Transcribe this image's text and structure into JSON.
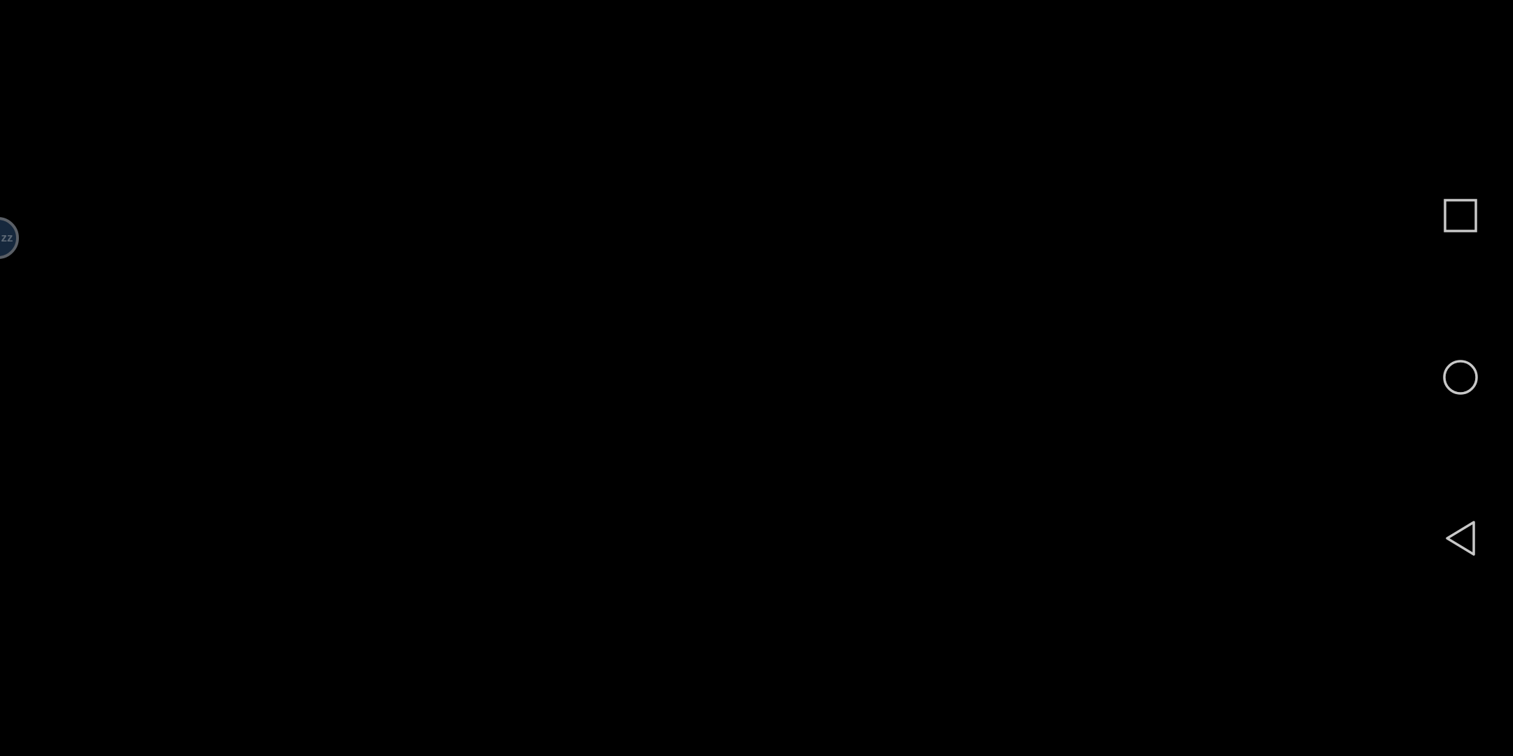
{
  "floating_bubble": {
    "label": "zz",
    "icon": "sleep-bubble-icon",
    "fill_color": "#16283d",
    "ring_color": "#5a5f66"
  },
  "navigation_bar": {
    "buttons": [
      {
        "name": "recents",
        "icon": "square-icon"
      },
      {
        "name": "home",
        "icon": "circle-icon"
      },
      {
        "name": "back",
        "icon": "triangle-back-icon"
      }
    ],
    "icon_color": "#c8c8c8"
  },
  "colors": {
    "background": "#000000"
  }
}
